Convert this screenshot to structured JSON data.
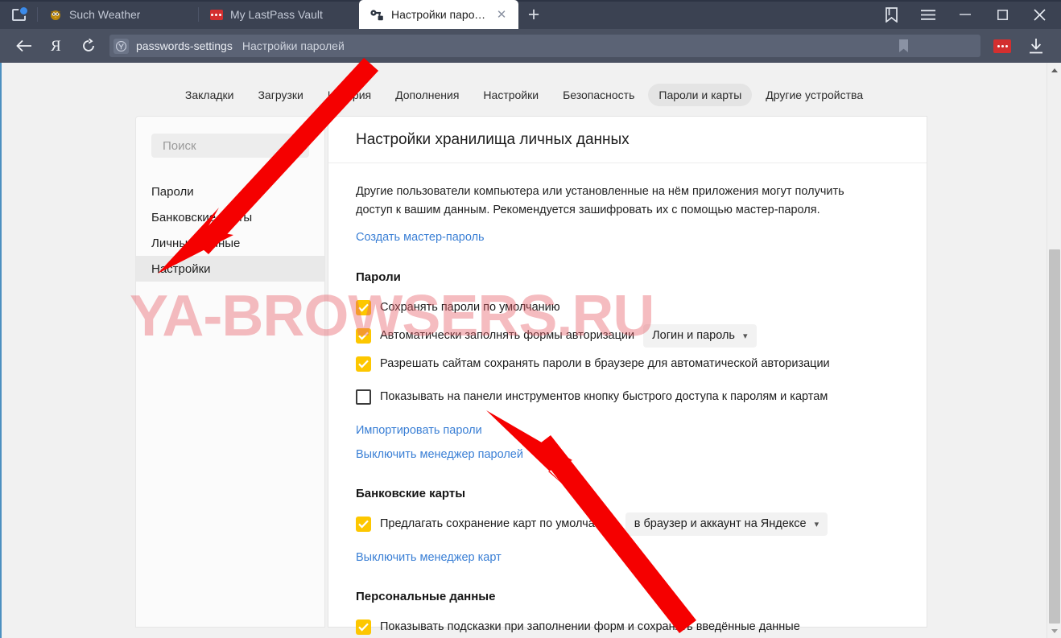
{
  "window": {
    "controls": {
      "minimize": "—",
      "maximize": "☐",
      "close": "✕"
    },
    "bookmarks_icon": "bookmark-ribbon-icon",
    "menu_icon": "hamburger-menu-icon"
  },
  "tabstrip": {
    "tab_list_button": "tab-list-icon",
    "new_tab_label": "+",
    "tabs": [
      {
        "title": "Such Weather",
        "icon": "weather-owl-icon",
        "active": false
      },
      {
        "title": "My LastPass Vault",
        "icon": "lastpass-icon",
        "active": false
      },
      {
        "title": "Настройки паролей",
        "icon": "key-icon",
        "active": true,
        "close": "✕"
      }
    ]
  },
  "navbar": {
    "back_icon": "back-arrow-icon",
    "yandex_icon": "yandex-logo-icon",
    "reload_icon": "reload-icon",
    "omnibox": {
      "favicon": "yandex-browser-icon",
      "url": "passwords-settings",
      "title": "Настройки паролей",
      "bookmark_icon": "bookmark-icon"
    },
    "extension_icon": "lastpass-extension-icon",
    "download_icon": "download-icon"
  },
  "settings_nav": {
    "items": [
      {
        "label": "Закладки",
        "active": false
      },
      {
        "label": "Загрузки",
        "active": false
      },
      {
        "label": "История",
        "active": false
      },
      {
        "label": "Дополнения",
        "active": false
      },
      {
        "label": "Настройки",
        "active": false
      },
      {
        "label": "Безопасность",
        "active": false
      },
      {
        "label": "Пароли и карты",
        "active": true
      },
      {
        "label": "Другие устройства",
        "active": false
      }
    ]
  },
  "sidebar": {
    "search_placeholder": "Поиск",
    "items": [
      {
        "label": "Пароли",
        "active": false
      },
      {
        "label": "Банковские карты",
        "active": false
      },
      {
        "label": "Личные данные",
        "active": false
      },
      {
        "label": "Настройки",
        "active": true
      }
    ]
  },
  "panel": {
    "title": "Настройки хранилища личных данных",
    "intro": "Другие пользователи компьютера или установленные на нём приложения могут получить доступ к вашим данным. Рекомендуется зашифровать их с помощью мастер-пароля.",
    "create_master_password_link": "Создать мастер-пароль",
    "sections": [
      {
        "title": "Пароли",
        "options": [
          {
            "label": "Сохранять пароли по умолчанию",
            "checked": true,
            "select": null
          },
          {
            "label": "Автоматически заполнять формы авторизации",
            "checked": true,
            "select": "Логин и пароль"
          },
          {
            "label": "Разрешать сайтам сохранять пароли в браузере для автоматической авторизации",
            "checked": true,
            "select": null
          },
          {
            "label": "Показывать на панели инструментов кнопку быстрого доступа к паролям и картам",
            "checked": false,
            "select": null
          }
        ],
        "links": [
          "Импортировать пароли",
          "Выключить менеджер паролей"
        ]
      },
      {
        "title": "Банковские карты",
        "options": [
          {
            "label": "Предлагать сохранение карт по умолчанию",
            "checked": true,
            "select": "в браузер и аккаунт на Яндексе"
          }
        ],
        "links": [
          "Выключить менеджер карт"
        ]
      },
      {
        "title": "Персональные данные",
        "options": [
          {
            "label": "Показывать подсказки при заполнении форм и сохранять введённые данные",
            "checked": true,
            "select": null
          }
        ],
        "links": []
      }
    ]
  },
  "watermark": {
    "text": "YA-BROWSERS.RU"
  },
  "colors": {
    "chrome_tabstrip": "#3b4252",
    "chrome_navbar": "#4a5161",
    "accent_link": "#3a7fd5",
    "checkbox_checked": "#fdc700",
    "annotation_arrow": "#f50000",
    "watermark": "#e86068",
    "page_background": "#f1f1f1"
  },
  "annotations": {
    "arrow_1": "red-arrow-pointing-to-sidebar-nastroyki",
    "arrow_2": "red-arrow-pointing-to-import-passwords-link"
  }
}
